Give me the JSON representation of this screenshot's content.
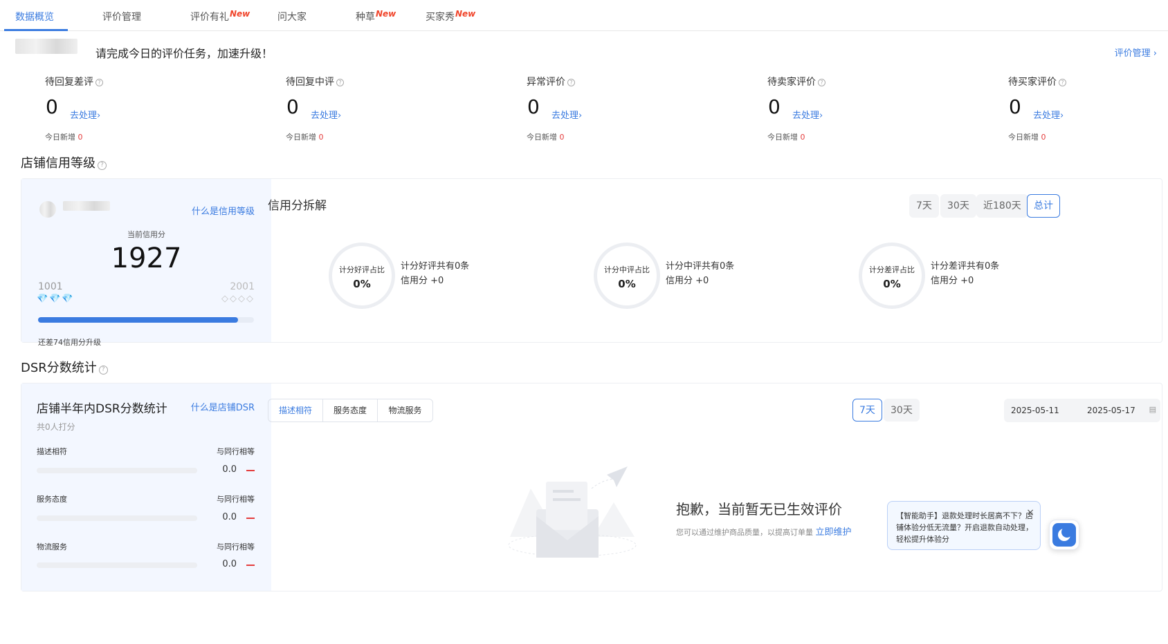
{
  "tabs": [
    {
      "label": "数据概览",
      "active": true
    },
    {
      "label": "评价管理"
    },
    {
      "label": "评价有礼",
      "badge": "New"
    },
    {
      "label": "问大家"
    },
    {
      "label": "种草",
      "badge": "New"
    },
    {
      "label": "买家秀",
      "badge": "New"
    }
  ],
  "greeting": "请完成今日的评价任务，加速升级！",
  "top_link": "评价管理 ›",
  "stats": [
    {
      "title": "待回复差评",
      "value": "0",
      "link": "去处理›",
      "sub_label": "今日新增",
      "sub_value": "0"
    },
    {
      "title": "待回复中评",
      "value": "0",
      "link": "去处理›",
      "sub_label": "今日新增",
      "sub_value": "0"
    },
    {
      "title": "异常评价",
      "value": "0",
      "link": "去处理›",
      "sub_label": "今日新增",
      "sub_value": "0"
    },
    {
      "title": "待卖家评价",
      "value": "0",
      "link": "去处理›",
      "sub_label": "今日新增",
      "sub_value": "0"
    },
    {
      "title": "待买家评价",
      "value": "0",
      "link": "去处理›",
      "sub_label": "今日新增",
      "sub_value": "0"
    }
  ],
  "credit": {
    "section_title": "店铺信用等级",
    "what_link": "什么是信用等级",
    "current_label": "当前信用分",
    "score": "1927",
    "range_low": "1001",
    "range_high": "2001",
    "progress_fraction": 0.926,
    "remaining_text": "还差74信用分升级",
    "breakdown_title": "信用分拆解",
    "periods": [
      "7天",
      "30天",
      "近180天",
      "总计"
    ],
    "active_period": "总计",
    "rings": [
      {
        "label": "计分好评占比",
        "value": "0%",
        "line1": "计分好评共有0条",
        "line2": "信用分 +0"
      },
      {
        "label": "计分中评占比",
        "value": "0%",
        "line1": "计分中评共有0条",
        "line2": "信用分 +0"
      },
      {
        "label": "计分差评占比",
        "value": "0%",
        "line1": "计分差评共有0条",
        "line2": "信用分 +0"
      }
    ]
  },
  "dsr": {
    "section_title": "DSR分数统计",
    "panel_title": "店铺半年内DSR分数统计",
    "what_link": "什么是店铺DSR",
    "count_text": "共0人打分",
    "rows": [
      {
        "label": "描述相符",
        "compare": "与同行相等",
        "value": "0.0"
      },
      {
        "label": "服务态度",
        "compare": "与同行相等",
        "value": "0.0"
      },
      {
        "label": "物流服务",
        "compare": "与同行相等",
        "value": "0.0"
      }
    ],
    "tabs": [
      "描述相符",
      "服务态度",
      "物流服务"
    ],
    "active_tab": "描述相符",
    "periods": [
      "7天",
      "30天"
    ],
    "active_period": "7天",
    "date_start": "2025-05-11",
    "date_end": "2025-05-17",
    "empty_title": "抱歉，当前暂无已生效评价",
    "empty_sub": "您可以通过维护商品质量，以提高订单量",
    "empty_link": "立即维护"
  },
  "assistant": {
    "text": "【智能助手】退款处理时长居高不下？店铺体验分低无流量？开启退款自动处理，轻松提升体验分",
    "close": "×"
  },
  "colors": {
    "accent": "#3a7be0",
    "danger": "#e43c3c",
    "new_badge": "#f0442a"
  }
}
